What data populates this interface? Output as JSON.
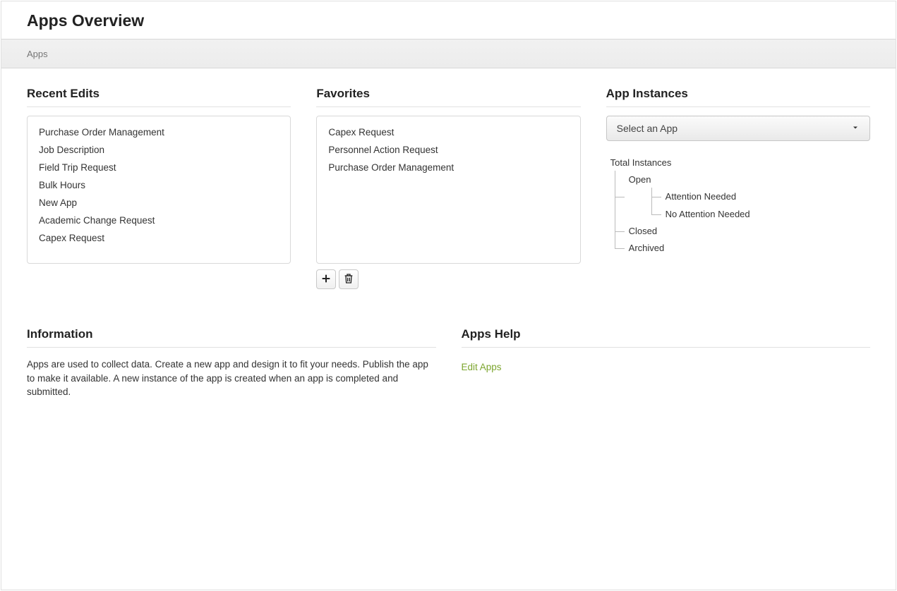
{
  "header": {
    "title": "Apps Overview"
  },
  "breadcrumb": {
    "label": "Apps"
  },
  "recentEdits": {
    "title": "Recent Edits",
    "items": [
      "Purchase Order Management",
      "Job Description",
      "Field Trip Request",
      "Bulk Hours",
      "New App",
      "Academic Change Request",
      "Capex Request"
    ]
  },
  "favorites": {
    "title": "Favorites",
    "items": [
      "Capex Request",
      "Personnel Action Request",
      "Purchase Order Management"
    ]
  },
  "appInstances": {
    "title": "App Instances",
    "selectLabel": "Select an App",
    "tree": {
      "root": "Total Instances",
      "children": [
        {
          "label": "Open",
          "children": [
            "Attention Needed",
            "No Attention Needed"
          ]
        },
        {
          "label": "Closed",
          "children": []
        },
        {
          "label": "Archived",
          "children": []
        }
      ]
    }
  },
  "information": {
    "title": "Information",
    "body": "Apps are used to collect data. Create a new app and design it to fit your needs. Publish the app to make it available. A new instance of the app is created when an app is completed and submitted."
  },
  "help": {
    "title": "Apps Help",
    "linkLabel": "Edit Apps"
  },
  "icons": {
    "add": "plus-icon",
    "delete": "trash-icon",
    "caret": "caret-down-icon"
  }
}
